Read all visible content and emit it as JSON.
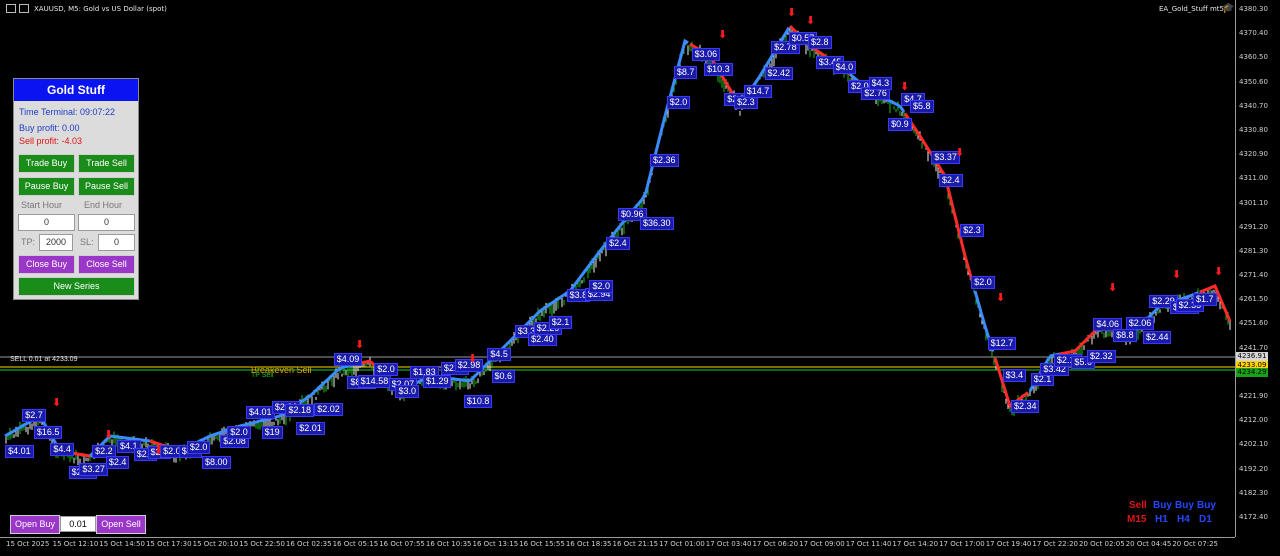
{
  "header": {
    "symbol_info": "XAUUSD, M5:  Gold vs US Dollar (spot)",
    "ea_name": "EA_Gold_Stuff mt5",
    "icons": [
      "window-icon",
      "window-icon",
      "hat-icon"
    ]
  },
  "price_axis": [
    "4380.30",
    "4370.40",
    "4360.50",
    "4350.60",
    "4340.70",
    "4330.80",
    "4320.90",
    "4311.00",
    "4301.10",
    "4291.20",
    "4281.30",
    "4271.40",
    "4261.50",
    "4251.60",
    "4241.70",
    "4231.80",
    "4221.90",
    "4212.00",
    "4202.10",
    "4192.20",
    "4182.30",
    "4172.40"
  ],
  "time_axis": [
    "15 Oct 2025",
    "15 Oct 12:10",
    "15 Oct 14:50",
    "15 Oct 17:30",
    "15 Oct 20:10",
    "15 Oct 22:50",
    "16 Oct 02:35",
    "16 Oct 05:15",
    "16 Oct 07:55",
    "16 Oct 10:35",
    "16 Oct 13:15",
    "16 Oct 15:55",
    "16 Oct 18:35",
    "16 Oct 21:15",
    "17 Oct 01:00",
    "17 Oct 03:40",
    "17 Oct 06:20",
    "17 Oct 09:00",
    "17 Oct 11:40",
    "17 Oct 14:20",
    "17 Oct 17:00",
    "17 Oct 19:40",
    "17 Oct 22:20",
    "20 Oct 02:05",
    "20 Oct 04:45",
    "20 Oct 07:25"
  ],
  "price_boxes": {
    "current": "4236.91",
    "bid": "4233.09",
    "ask": "4234.29"
  },
  "lines": {
    "sell_order": "SELL 0.01 at 4233.09",
    "breakeven": "Breakeven Sell",
    "tp": "TP Sell"
  },
  "panel": {
    "title": "Gold Stuff",
    "time_terminal": "Time Terminal: 09:07:22",
    "buy_profit": "Buy profit: 0.00",
    "sell_profit": "Sell profit: -4.03",
    "trade_buy": "Trade Buy",
    "trade_sell": "Trade Sell",
    "pause_buy": "Pause Buy",
    "pause_sell": "Pause Sell",
    "start_hour_label": "Start Hour",
    "end_hour_label": "End Hour",
    "start_hour_value": "0",
    "end_hour_value": "0",
    "tp_label": "TP:",
    "tp_value": "2000",
    "sl_label": "SL:",
    "sl_value": "0",
    "close_buy": "Close Buy",
    "close_sell": "Close Sell",
    "new_series": "New Series"
  },
  "bottom_controls": {
    "open_buy": "Open Buy",
    "lot": "0.01",
    "open_sell": "Open Sell"
  },
  "trend_matrix": {
    "signals": [
      "Sell",
      "Buy",
      "Buy",
      "Buy"
    ],
    "timeframes": [
      "M15",
      "H1",
      "H4",
      "D1"
    ]
  },
  "profit_labels": [
    "$4.01",
    "$2.7",
    "$16.5",
    "$4.4",
    "$2.05",
    "$3.27",
    "$2.2",
    "$2.4",
    "$4.1",
    "$2.0",
    "$2.5",
    "$2.04",
    "$3.0",
    "$2.0",
    "$8.00",
    "$2.08",
    "$2.0",
    "$4.01",
    "$19",
    "$2.20",
    "$2.18",
    "$2.01",
    "$2.02",
    "$4.09",
    "$8.22",
    "$14.58",
    "$2.0",
    "$2.07",
    "$3.0",
    "$1.83",
    "$1.29",
    "$2.27",
    "$2.98",
    "$10.8",
    "$4.5",
    "$0.6",
    "$3.3",
    "$2.40",
    "$2.29",
    "$2.1",
    "$3.8",
    "$2.94",
    "$2.0",
    "$2.4",
    "$0.96",
    "$36.30",
    "$2.36",
    "$2.0",
    "$8.7",
    "$3.06",
    "$10.3",
    "$2.9",
    "$2.3",
    "$14.7",
    "$2.42",
    "$2.78",
    "$0.57",
    "$2.8",
    "$3.45",
    "$4.0",
    "$2.0",
    "$2.76",
    "$4.3",
    "$0.9",
    "$4.7",
    "$5.8",
    "$3.37",
    "$2.4",
    "$2.3",
    "$2.0",
    "$12.7",
    "$3.4",
    "$2.34",
    "$2.1",
    "$3.42",
    "$2.10",
    "$5.6",
    "$2.32",
    "$4.06",
    "$8.8",
    "$2.06",
    "$2.44",
    "$2.29",
    "$2.15",
    "$2.35",
    "$1.7"
  ]
}
